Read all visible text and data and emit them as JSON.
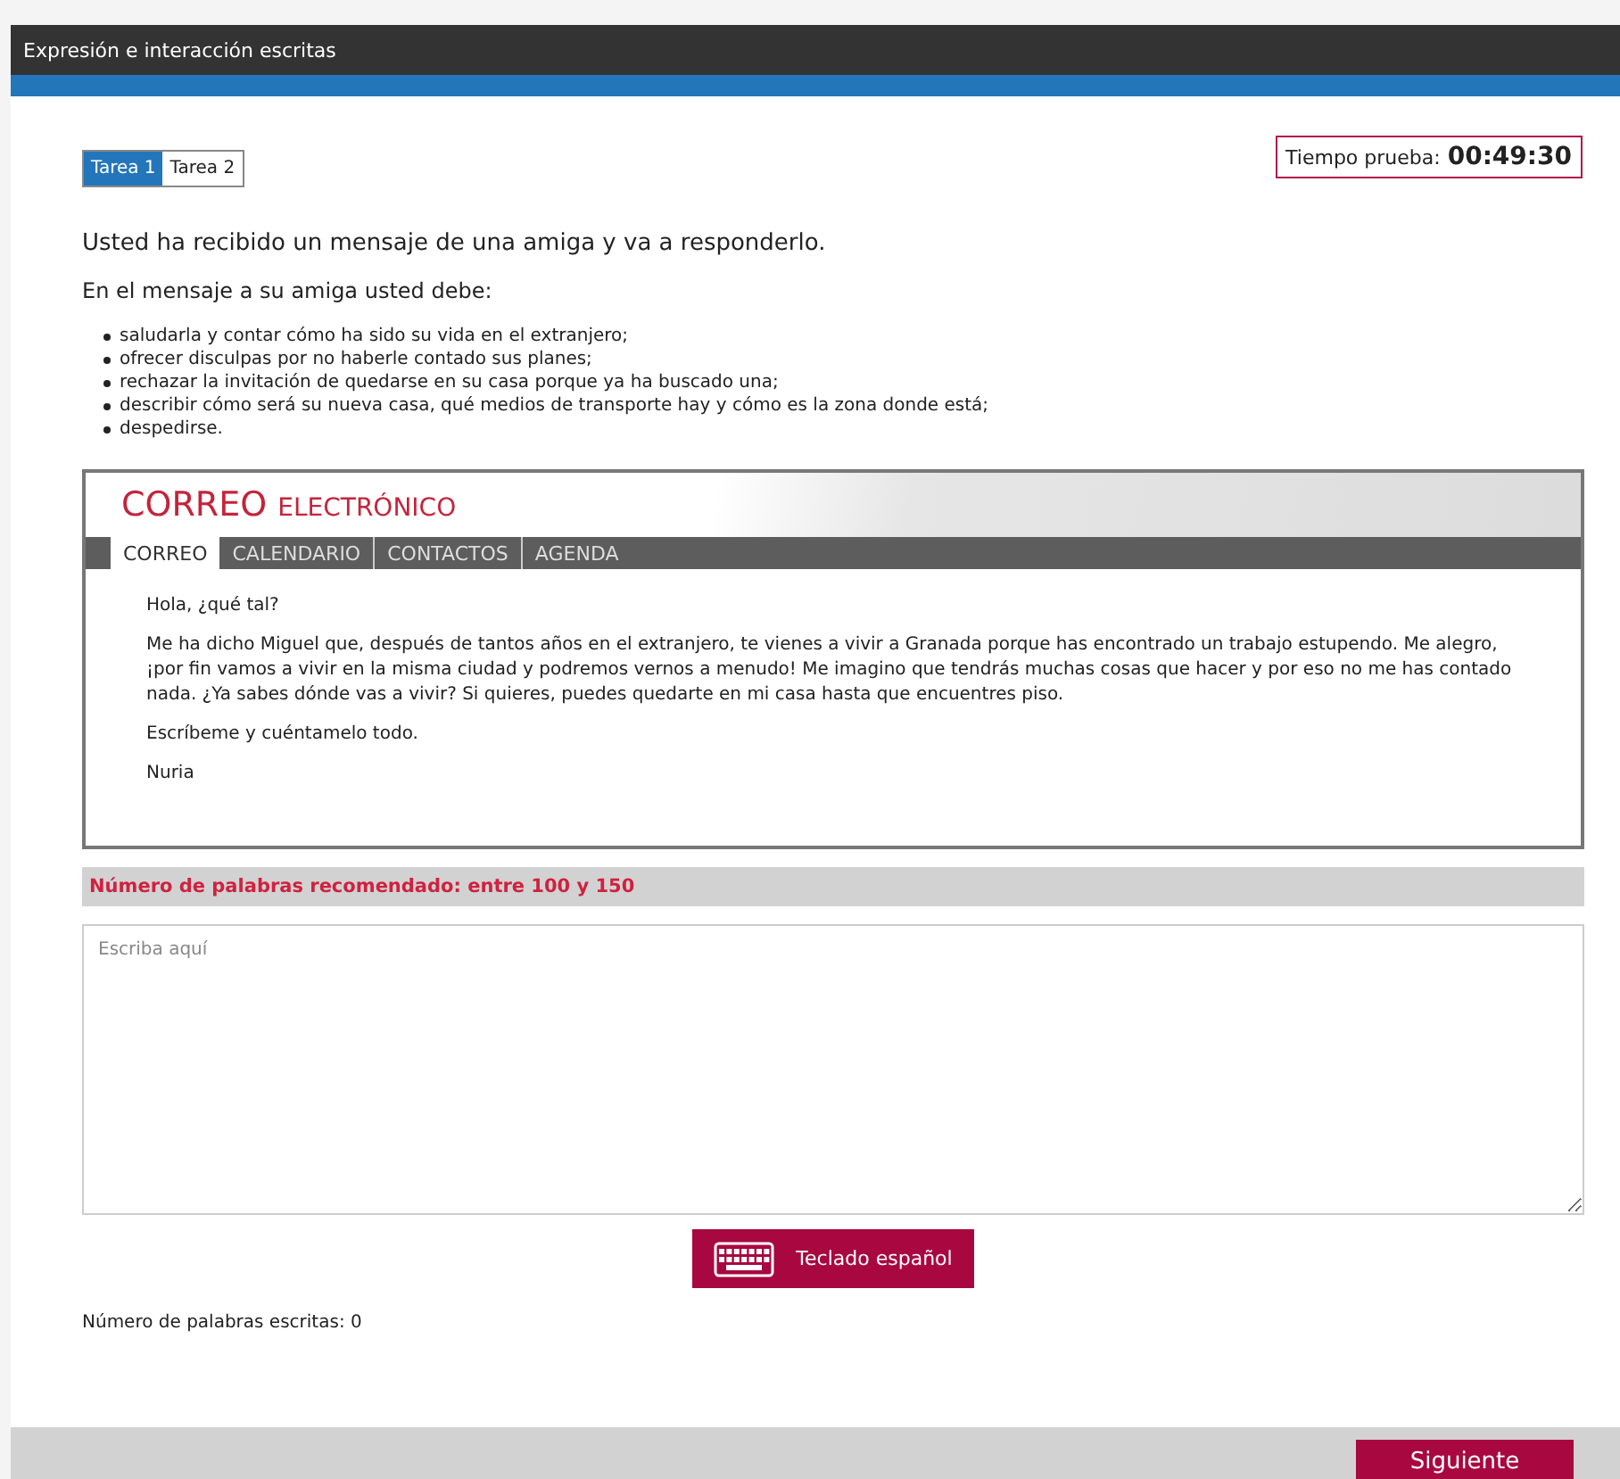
{
  "header": {
    "title": "Expresión e interacción escritas"
  },
  "tabs": [
    {
      "label": "Tarea 1",
      "selected": true
    },
    {
      "label": "Tarea 2",
      "selected": false
    }
  ],
  "timer": {
    "label": "Tiempo prueba:",
    "value": "00:49:30"
  },
  "intro": "Usted ha recibido un mensaje de una amiga y va a responderlo.",
  "task_lead": "En el mensaje a su amiga usted debe:",
  "task_items": [
    "saludarla y contar cómo ha sido su vida en el extranjero;",
    "ofrecer disculpas por no haberle contado sus planes;",
    "rechazar la invitación de quedarse en su casa porque ya ha buscado una;",
    "describir cómo será su nueva casa, qué medios de transporte hay y cómo es la zona donde está;",
    "despedirse."
  ],
  "email": {
    "brand_main": "CORREO",
    "brand_sub": "ELECTRÓNICO",
    "nav": [
      {
        "label": "CORREO",
        "selected": true
      },
      {
        "label": "CALENDARIO",
        "selected": false
      },
      {
        "label": "CONTACTOS",
        "selected": false
      },
      {
        "label": "AGENDA",
        "selected": false
      }
    ],
    "paragraphs": [
      "Hola, ¿qué tal?",
      "Me ha dicho Miguel que, después de tantos años en el extranjero, te vienes a vivir a Granada porque has encontrado un trabajo estupendo. Me alegro, ¡por fin vamos a vivir en la misma ciudad y podremos vernos a menudo! Me imagino que tendrás muchas cosas que hacer y por eso no me has contado nada. ¿Ya sabes dónde vas a vivir? Si quieres, puedes quedarte en mi casa hasta que encuentres piso.",
      "Escríbeme y cuéntamelo todo.",
      "Nuria"
    ]
  },
  "recommended": "Número de palabras recomendado: entre 100 y 150",
  "answer": {
    "placeholder": "Escriba aquí"
  },
  "keyboard_button": "Teclado español",
  "word_count": "Número de palabras escritas: 0",
  "next_button": "Siguiente"
}
